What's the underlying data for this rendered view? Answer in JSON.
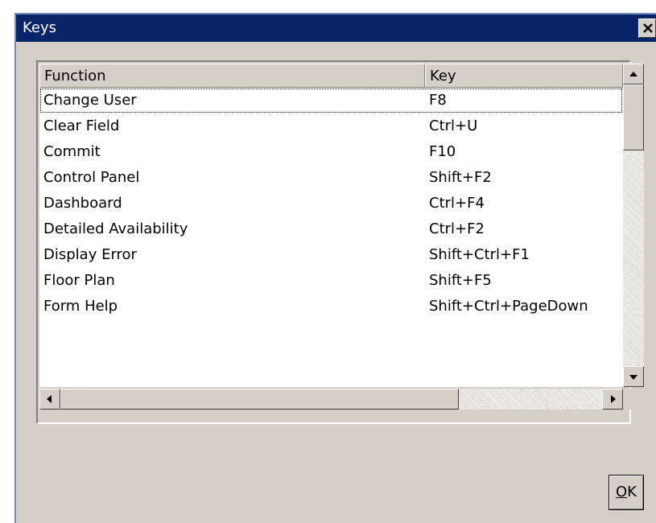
{
  "window": {
    "title": "Keys"
  },
  "icons": {
    "close": "close-icon",
    "up": "arrow-up-icon",
    "down": "arrow-down-icon",
    "left": "arrow-left-icon",
    "right": "arrow-right-icon"
  },
  "table": {
    "columns": [
      "Function",
      "Key"
    ],
    "rows": [
      {
        "function": "Change User",
        "key": "F8",
        "selected": true
      },
      {
        "function": "Clear Field",
        "key": "Ctrl+U"
      },
      {
        "function": "Commit",
        "key": "F10"
      },
      {
        "function": "Control Panel",
        "key": "Shift+F2"
      },
      {
        "function": "Dashboard",
        "key": "Ctrl+F4"
      },
      {
        "function": "Detailed Availability",
        "key": "Ctrl+F2"
      },
      {
        "function": "Display Error",
        "key": "Shift+Ctrl+F1"
      },
      {
        "function": "Floor Plan",
        "key": "Shift+F5"
      },
      {
        "function": "Form Help",
        "key": "Shift+Ctrl+PageDown"
      }
    ]
  },
  "buttons": {
    "ok_mnemonic": "O",
    "ok_rest": "K"
  }
}
